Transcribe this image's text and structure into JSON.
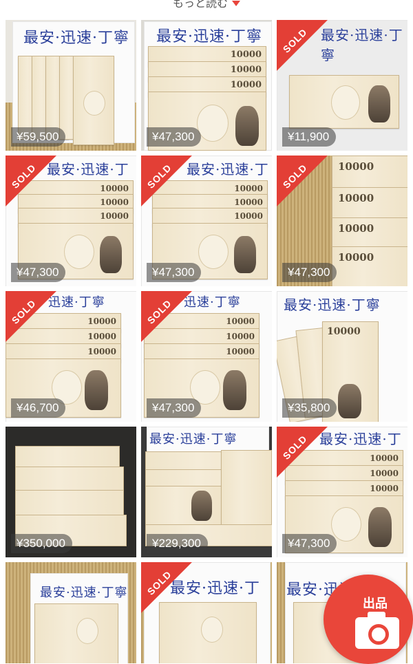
{
  "header": {
    "read_more": "もっと読む"
  },
  "items": [
    {
      "price": "¥59,500",
      "sold": false,
      "note": "最安·迅速·丁寧"
    },
    {
      "price": "¥47,300",
      "sold": false,
      "note": "最安·迅速·丁寧"
    },
    {
      "price": "¥11,900",
      "sold": true,
      "note": "最安·迅速·丁寧"
    },
    {
      "price": "¥47,300",
      "sold": true,
      "note": "最安·迅速·丁寧"
    },
    {
      "price": "¥47,300",
      "sold": true,
      "note": "最安·迅速·丁寧"
    },
    {
      "price": "¥47,300",
      "sold": true,
      "note": ""
    },
    {
      "price": "¥46,700",
      "sold": true,
      "note": "迅速·丁寧"
    },
    {
      "price": "¥47,300",
      "sold": true,
      "note": "迅速·丁寧"
    },
    {
      "price": "¥35,800",
      "sold": false,
      "note": "最安·迅速·丁寧"
    },
    {
      "price": "¥350,000",
      "sold": false,
      "note": ""
    },
    {
      "price": "¥229,300",
      "sold": false,
      "note": "最安·迅速·丁寧"
    },
    {
      "price": "¥47,300",
      "sold": true,
      "note": "最安·迅速·丁寧"
    },
    {
      "price": "",
      "sold": false,
      "note": "最安·迅速·丁寧"
    },
    {
      "price": "",
      "sold": true,
      "note": "最安·迅速·丁寧"
    },
    {
      "price": "",
      "sold": false,
      "note": "最安·迅速·丁寧"
    }
  ],
  "sold_label": "SOLD",
  "fab": {
    "label": "出品",
    "icon": "camera-icon"
  },
  "colors": {
    "accent": "#e9463a",
    "sold": "#e33f36",
    "handwriting": "#2a3f9a"
  }
}
